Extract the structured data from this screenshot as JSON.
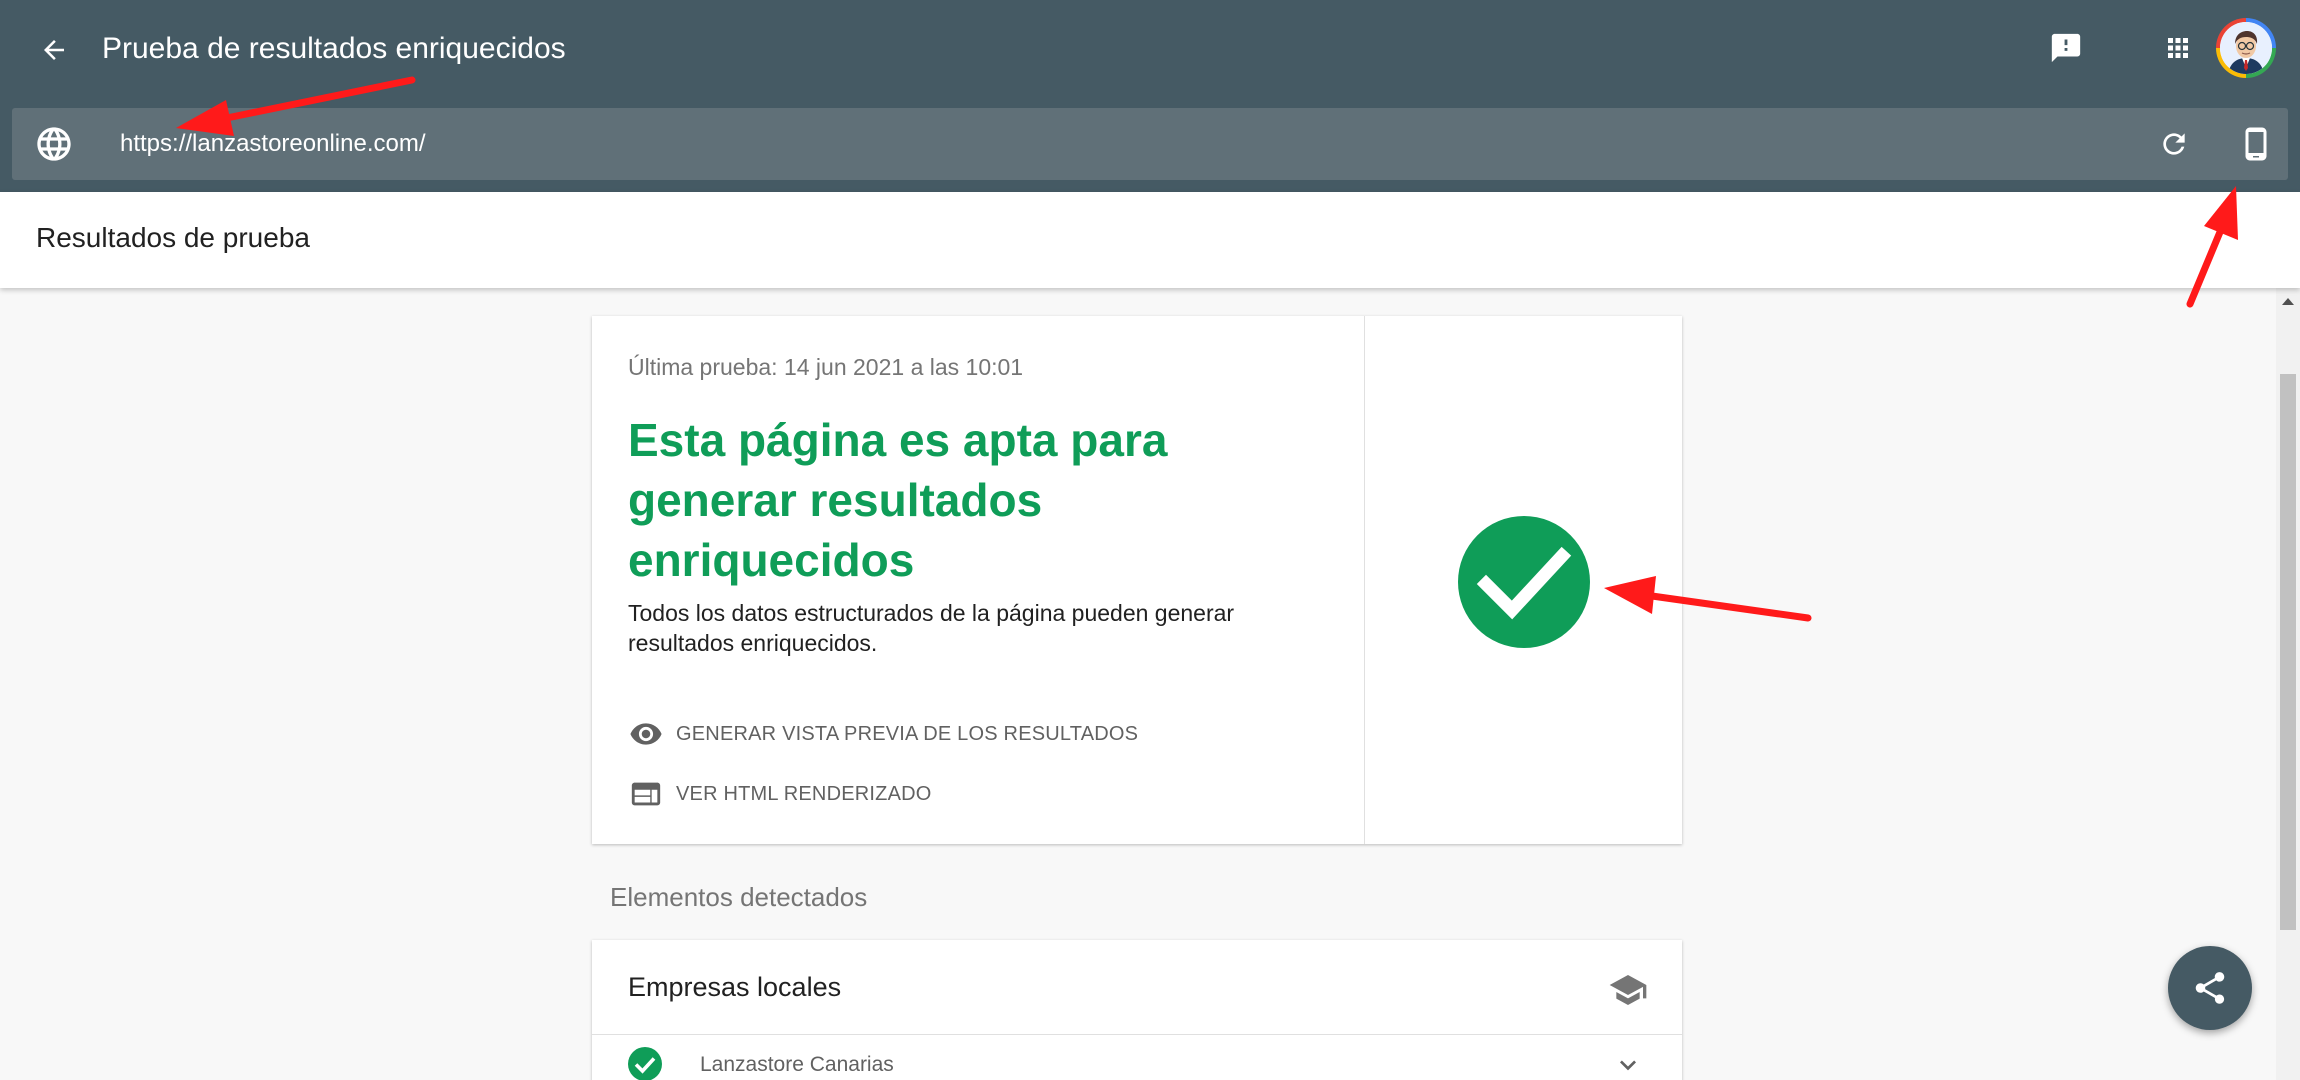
{
  "header": {
    "title": "Prueba de resultados enriquecidos",
    "icons": {
      "back": "arrow-back-icon",
      "feedback": "feedback-icon",
      "apps": "apps-grid-icon"
    }
  },
  "url_bar": {
    "value": "https://lanzastoreonline.com/",
    "icons": {
      "globe": "globe-icon",
      "reload": "reload-icon",
      "device": "smartphone-icon"
    }
  },
  "results_header": {
    "title": "Resultados de prueba"
  },
  "summary_card": {
    "last_test": "Última prueba: 14 jun 2021 a las 10:01",
    "headline": "Esta página es apta para generar resultados enriquecidos",
    "description": "Todos los datos estructurados de la página pueden generar resultados enriquecidos.",
    "actions": [
      {
        "label": "GENERAR VISTA PREVIA DE LOS RESULTADOS",
        "icon": "eye-icon"
      },
      {
        "label": "VER HTML RENDERIZADO",
        "icon": "web-page-icon"
      }
    ],
    "status_icon": "check-circle-icon"
  },
  "detected": {
    "label": "Elementos detectados",
    "groups": [
      {
        "title": "Empresas locales",
        "icon": "school-cap-icon",
        "items": [
          {
            "label": "Lanzastore Canarias",
            "status": "valid"
          }
        ]
      }
    ]
  },
  "fab": {
    "icon": "share-icon"
  },
  "colors": {
    "appbar": "#455a64",
    "urlbar": "#607078",
    "success": "#0f9d58",
    "annotation": "#ff1a1a"
  }
}
